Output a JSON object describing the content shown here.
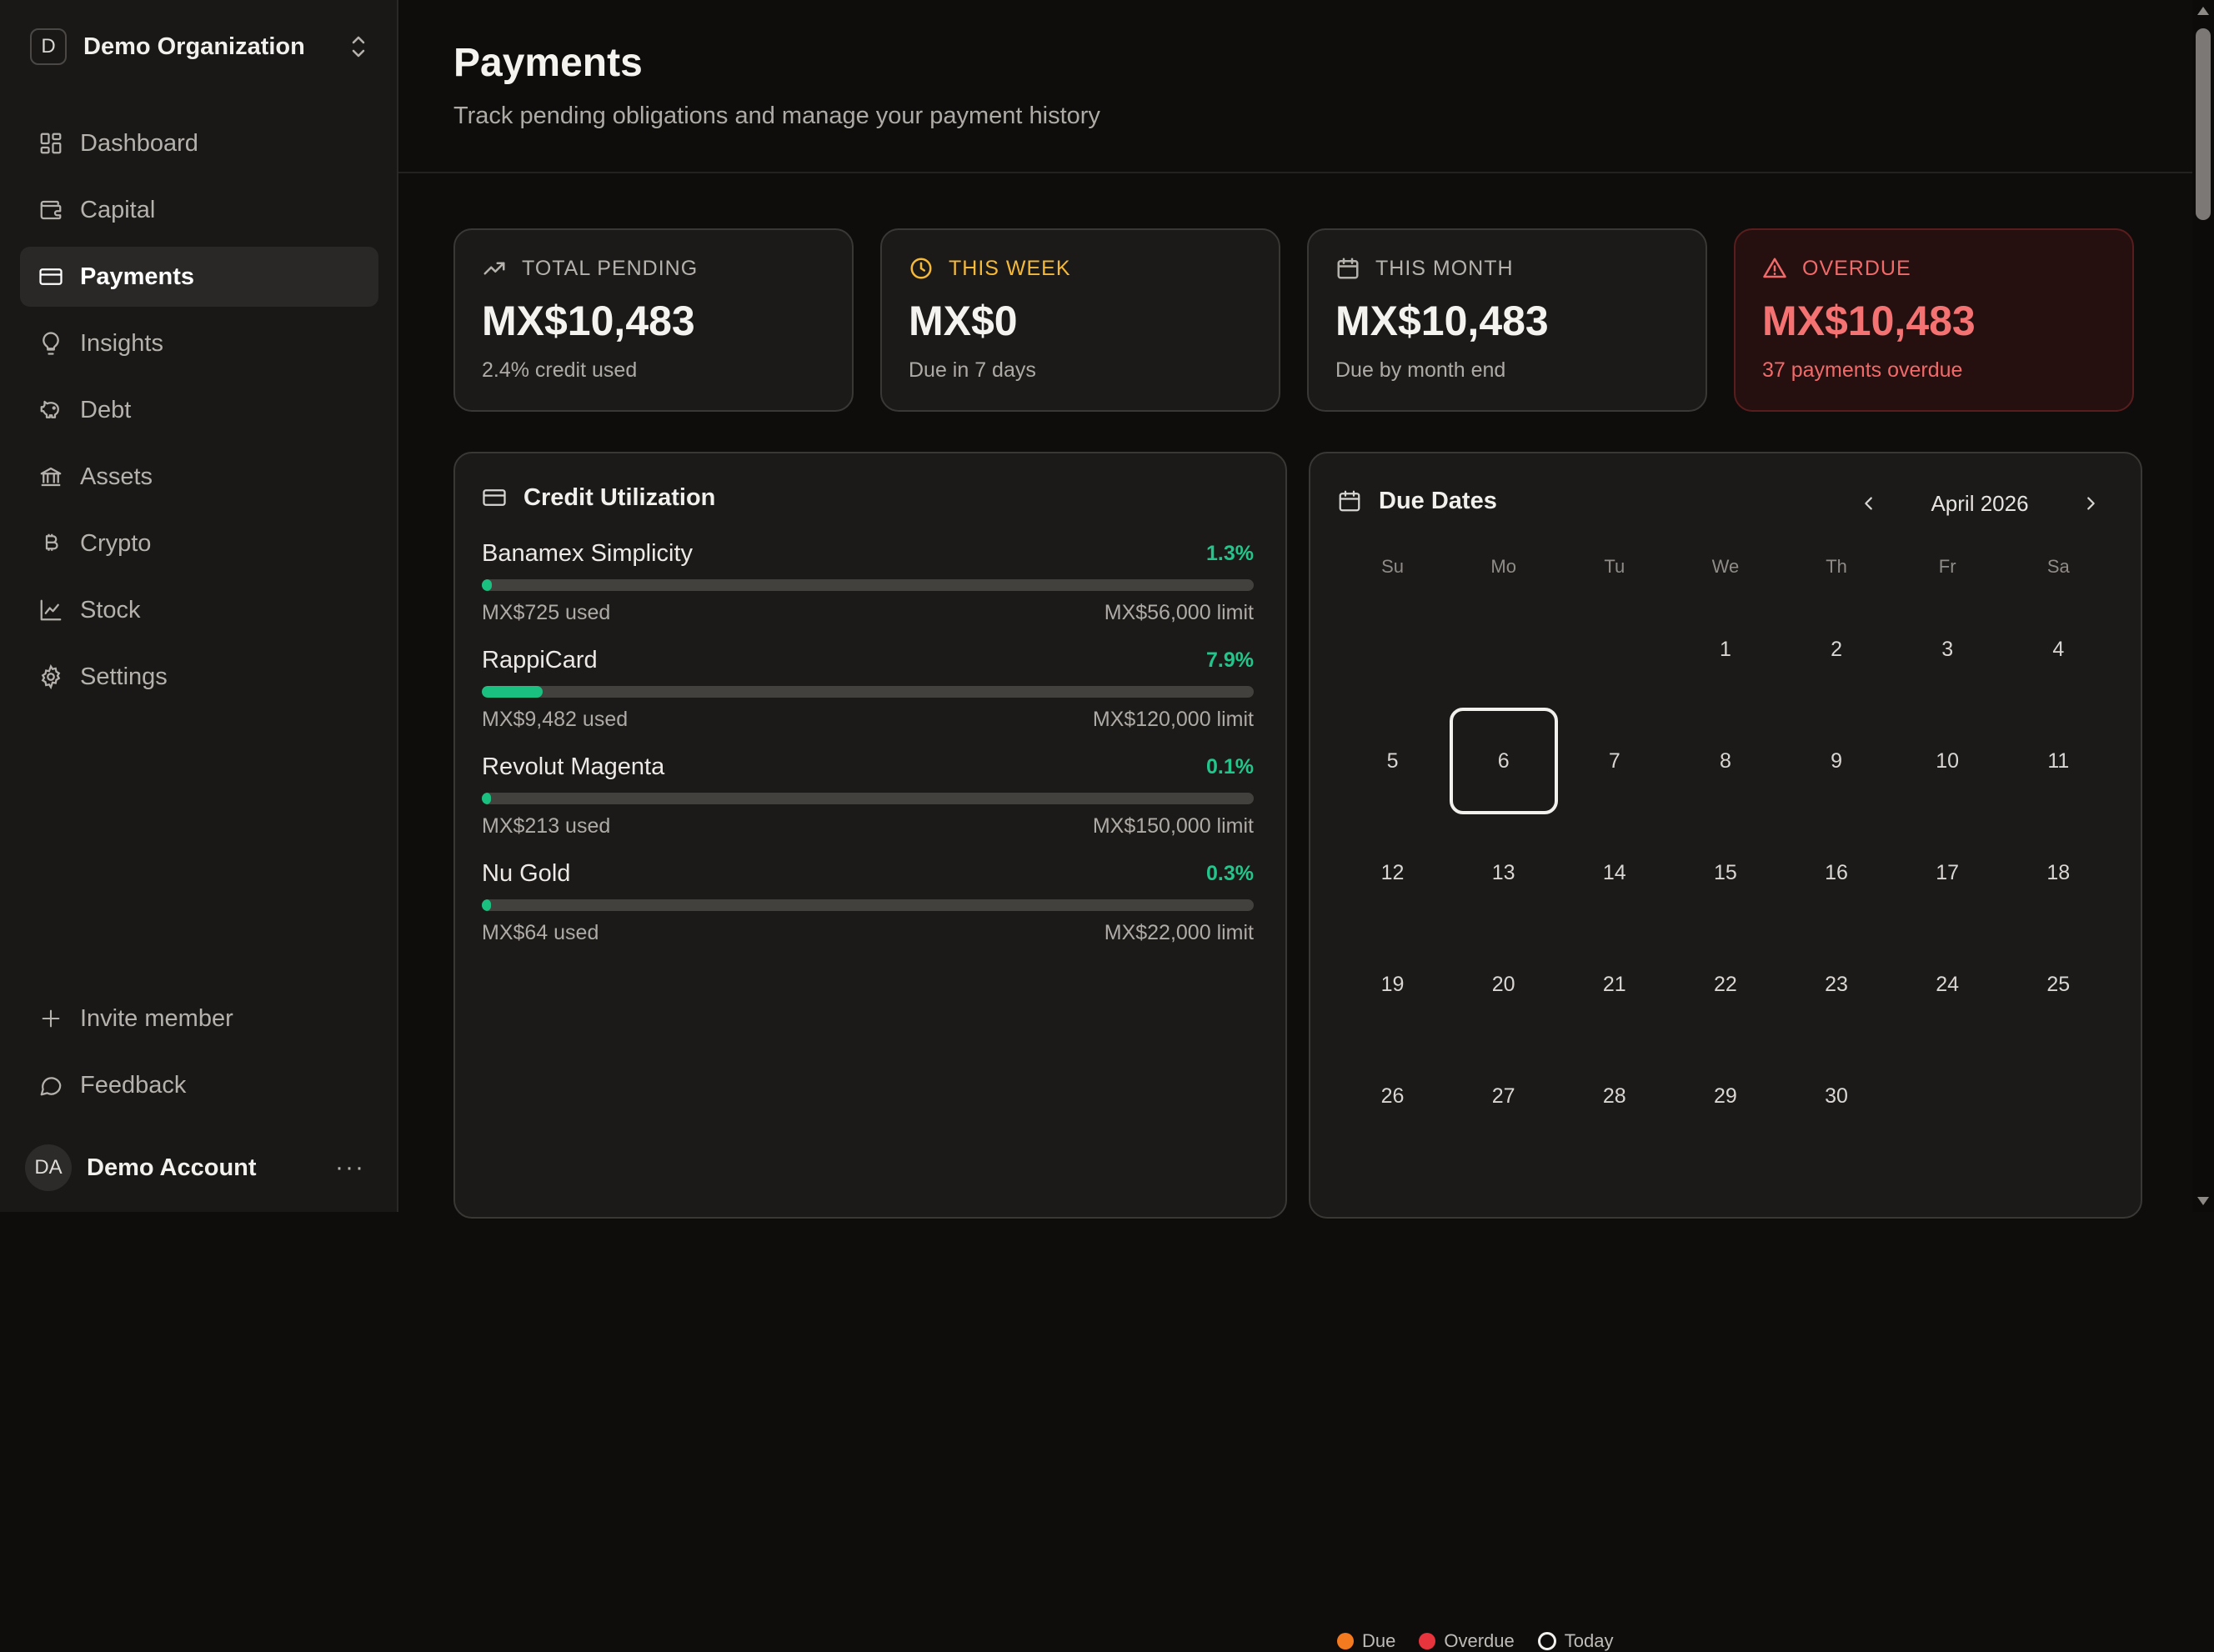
{
  "org": {
    "initial": "D",
    "name": "Demo Organization"
  },
  "nav": {
    "items": [
      {
        "label": "Dashboard",
        "icon": "dashboard-icon"
      },
      {
        "label": "Capital",
        "icon": "wallet-icon"
      },
      {
        "label": "Payments",
        "icon": "credit-card-icon",
        "active": true
      },
      {
        "label": "Insights",
        "icon": "lightbulb-icon"
      },
      {
        "label": "Debt",
        "icon": "piggy-bank-icon"
      },
      {
        "label": "Assets",
        "icon": "bank-icon"
      },
      {
        "label": "Crypto",
        "icon": "bitcoin-icon"
      },
      {
        "label": "Stock",
        "icon": "line-chart-icon"
      },
      {
        "label": "Settings",
        "icon": "gear-icon"
      }
    ],
    "invite": "Invite member",
    "feedback": "Feedback"
  },
  "account": {
    "initials": "DA",
    "name": "Demo Account",
    "more": "···"
  },
  "header": {
    "title": "Payments",
    "subtitle": "Track pending obligations and manage your payment history"
  },
  "stats": {
    "total": {
      "label": "TOTAL PENDING",
      "value": "MX$10,483",
      "sub": "2.4% credit used"
    },
    "week": {
      "label": "THIS WEEK",
      "value": "MX$0",
      "sub": "Due in 7 days"
    },
    "month": {
      "label": "THIS MONTH",
      "value": "MX$10,483",
      "sub": "Due by month end"
    },
    "overdue": {
      "label": "OVERDUE",
      "value": "MX$10,483",
      "sub": "37 payments overdue"
    }
  },
  "credit": {
    "title": "Credit Utilization",
    "cards": [
      {
        "name": "Banamex Simplicity",
        "pct": "1.3%",
        "fill": 0.013,
        "used": "MX$725 used",
        "limit": "MX$56,000 limit"
      },
      {
        "name": "RappiCard",
        "pct": "7.9%",
        "fill": 0.079,
        "used": "MX$9,482 used",
        "limit": "MX$120,000 limit"
      },
      {
        "name": "Revolut Magenta",
        "pct": "0.1%",
        "fill": 0.001,
        "used": "MX$213 used",
        "limit": "MX$150,000 limit"
      },
      {
        "name": "Nu Gold",
        "pct": "0.3%",
        "fill": 0.003,
        "used": "MX$64 used",
        "limit": "MX$22,000 limit"
      }
    ]
  },
  "due": {
    "title": "Due Dates",
    "month": "April 2026",
    "weekdays": [
      "Su",
      "Mo",
      "Tu",
      "We",
      "Th",
      "Fr",
      "Sa"
    ],
    "lead_blanks": 3,
    "days_in_month": 30,
    "today": 6,
    "legend": {
      "due": "Due",
      "overdue": "Overdue",
      "today": "Today"
    }
  },
  "colors": {
    "accent_green": "#19c07f",
    "warning": "#f5b93a",
    "danger": "#f47272",
    "due_dot": "#f47a1f",
    "overdue_dot": "#e8343c"
  }
}
